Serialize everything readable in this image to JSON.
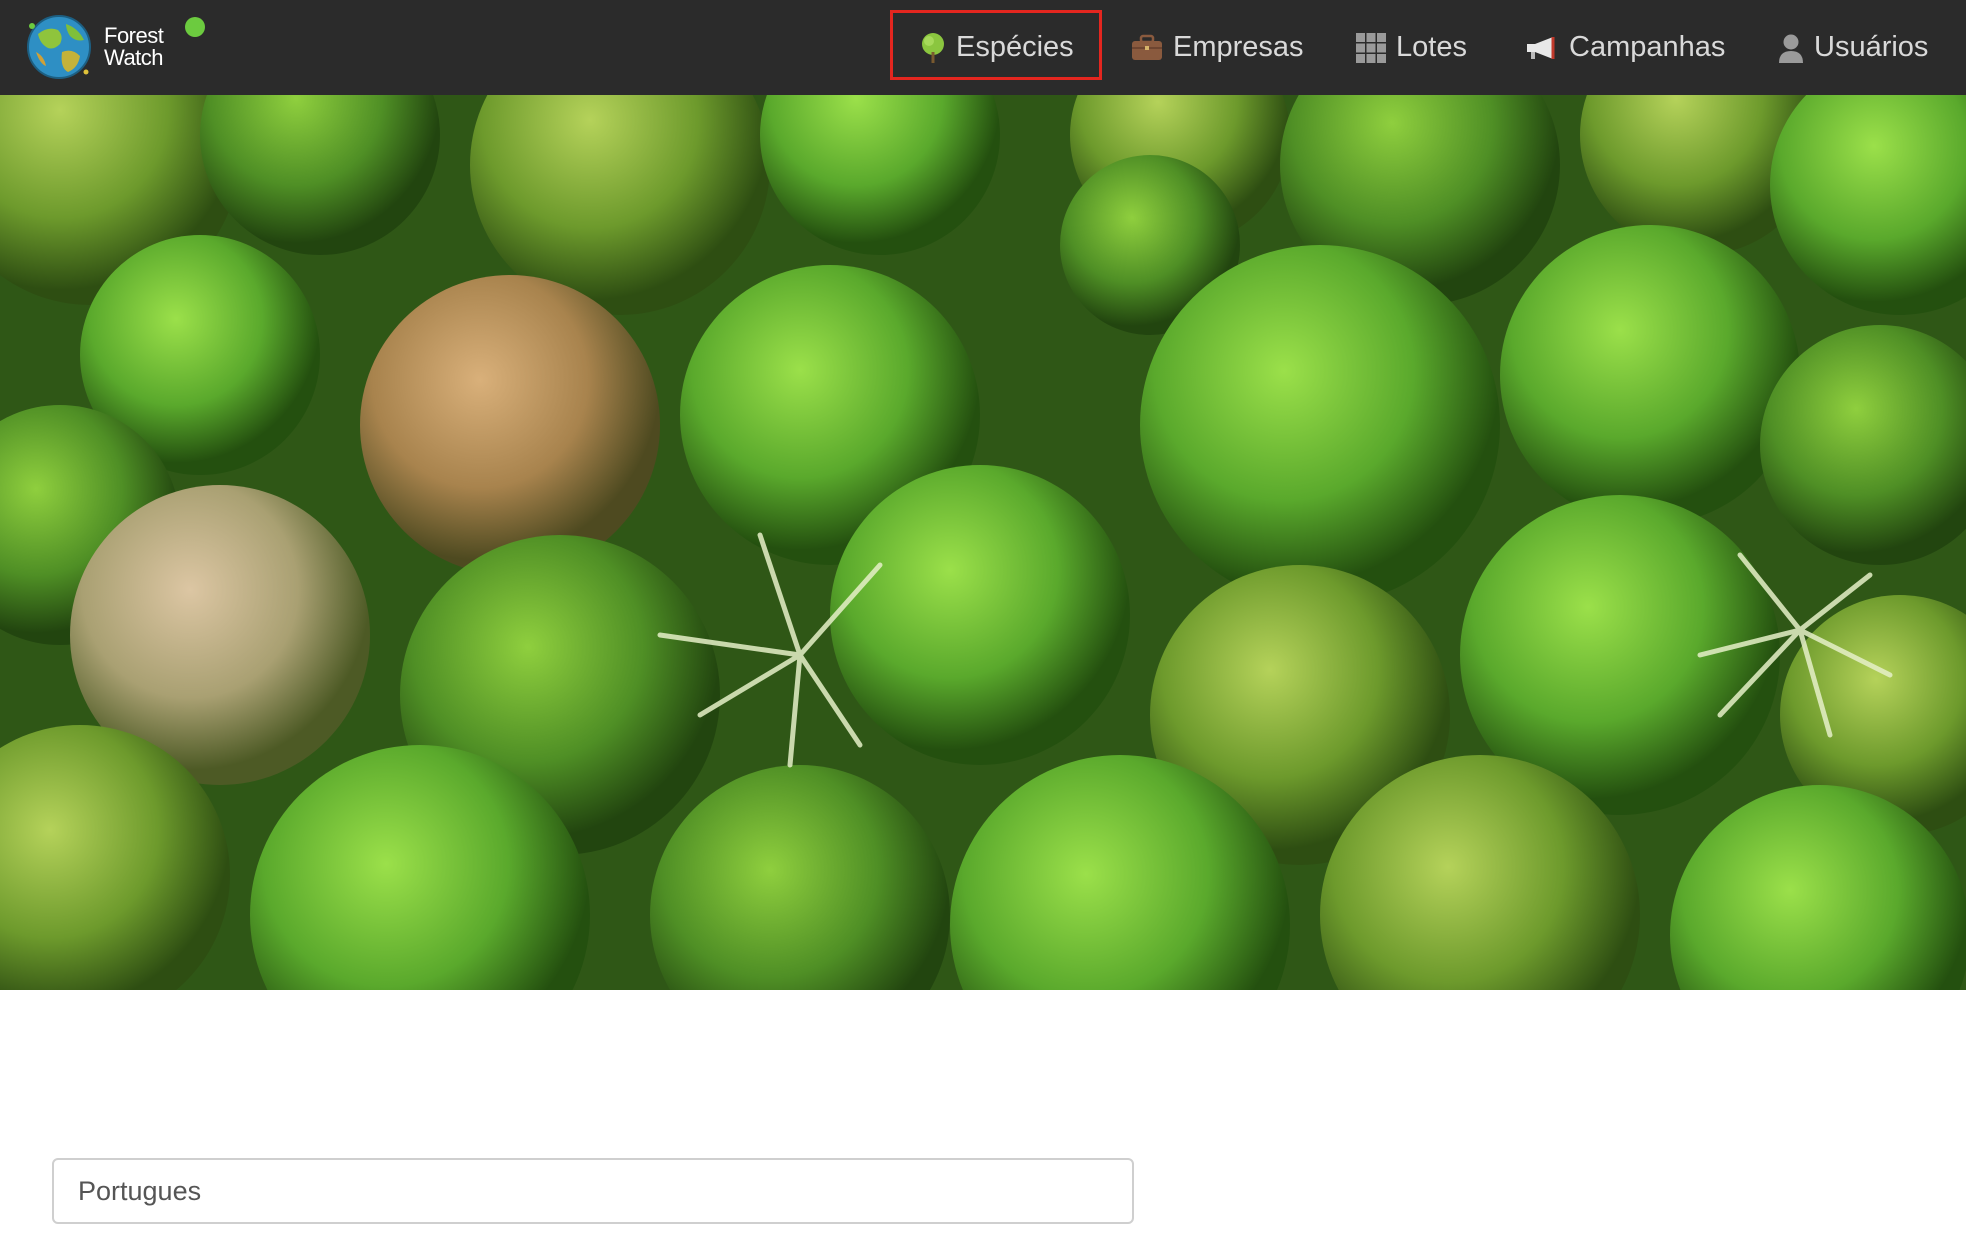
{
  "app": {
    "logo_line1": "Forest",
    "logo_line2": "Watch",
    "status_color": "#6ccb3f"
  },
  "nav": {
    "items": [
      {
        "label": "Espécies",
        "icon": "tree-icon",
        "selected": true
      },
      {
        "label": "Empresas",
        "icon": "briefcase-icon",
        "selected": false
      },
      {
        "label": "Lotes",
        "icon": "grid-icon",
        "selected": false
      },
      {
        "label": "Campanhas",
        "icon": "megaphone-icon",
        "selected": false
      },
      {
        "label": "Usuários",
        "icon": "user-icon",
        "selected": false
      }
    ],
    "highlight_color": "#e4261f"
  },
  "hero": {
    "image": "forest-canopy-aerial"
  },
  "language_select": {
    "value": "Portugues"
  },
  "colors": {
    "topbar": "#2b2b2b",
    "nav_text": "#d9d9d9"
  }
}
